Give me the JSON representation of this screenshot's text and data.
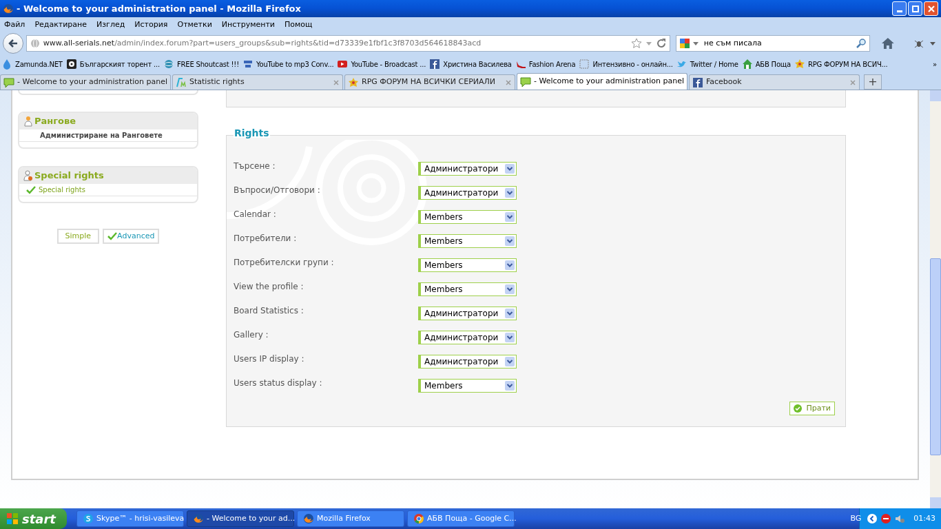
{
  "window": {
    "title": "- Welcome to your administration panel - Mozilla Firefox"
  },
  "menu": [
    "Файл",
    "Редактиране",
    "Изглед",
    "История",
    "Отметки",
    "Инструменти",
    "Помощ"
  ],
  "address": {
    "host": "www.all-serials.net",
    "path": "/admin/index.forum?part=users_groups&sub=rights&tid=d73339e1fbf1c3f8703d564618843acd"
  },
  "search": {
    "value": "не съм писала"
  },
  "bookmarks": [
    {
      "label": "Zamunda.NET",
      "kind": "drop"
    },
    {
      "label": "Българският торент ...",
      "kind": "disc"
    },
    {
      "label": "FREE Shoutcast !!!",
      "kind": "globe"
    },
    {
      "label": "YouTube to mp3 Conv...",
      "kind": "yt"
    },
    {
      "label": "YouTube - Broadcast ...",
      "kind": "play"
    },
    {
      "label": "Христина Василева",
      "kind": "fb"
    },
    {
      "label": "Fashion Arena",
      "kind": "shoe"
    },
    {
      "label": "Интензивно - онлайн...",
      "kind": "blank"
    },
    {
      "label": "Twitter / Home",
      "kind": "bird"
    },
    {
      "label": "АБВ Поща",
      "kind": "house"
    },
    {
      "label": "RPG ФОРУМ НА ВСИЧ...",
      "kind": "star"
    }
  ],
  "more_bookmarks": "»",
  "tabs": [
    {
      "label": "- Welcome to your administration panel",
      "kind": "chat",
      "selected": false
    },
    {
      "label": "Statistic rights",
      "kind": "fm",
      "selected": false
    },
    {
      "label": "RPG ФОРУМ НА ВСИЧКИ СЕРИАЛИ",
      "kind": "star",
      "selected": false
    },
    {
      "label": "- Welcome to your administration panel",
      "kind": "chat",
      "selected": true
    },
    {
      "label": "Facebook",
      "kind": "fb",
      "selected": false
    }
  ],
  "new_tab": "+",
  "sidebar": [
    {
      "title": "Рангове",
      "kind": "rank",
      "items": [
        {
          "label": "Администриране на Ранговете",
          "selected": false
        }
      ]
    },
    {
      "title": "Special rights",
      "kind": "special",
      "items": [
        {
          "label": "Special rights",
          "selected": true
        }
      ]
    }
  ],
  "modes": [
    {
      "label": "Simple",
      "selected": false
    },
    {
      "label": "Advanced",
      "selected": true
    }
  ],
  "rights": {
    "title": "Rights",
    "rows": [
      {
        "label": "Търсене :",
        "value": "Администратори"
      },
      {
        "label": "Въпроси/Отговори :",
        "value": "Администратори"
      },
      {
        "label": "Calendar :",
        "value": "Members"
      },
      {
        "label": "Потребители :",
        "value": "Members"
      },
      {
        "label": "Потребителски групи :",
        "value": "Members"
      },
      {
        "label": "View the profile :",
        "value": "Members"
      },
      {
        "label": "Board Statistics :",
        "value": "Администратори"
      },
      {
        "label": "Gallery :",
        "value": "Администратори"
      },
      {
        "label": "Users IP display :",
        "value": "Администратори"
      },
      {
        "label": "Users status display :",
        "value": "Members"
      }
    ],
    "submit": "Прати"
  },
  "taskbar": {
    "start": "start",
    "items": [
      {
        "label": "Skype™ - hrisi-vasileva",
        "kind": "skype",
        "selected": false
      },
      {
        "label": "- Welcome to your ad...",
        "kind": "firefox",
        "selected": true
      },
      {
        "label": "Mozilla Firefox",
        "kind": "firefox",
        "selected": false
      },
      {
        "label": "АБВ Поща - Google C...",
        "kind": "chrome",
        "selected": false
      }
    ],
    "language": "BG",
    "clock": "01:43"
  }
}
